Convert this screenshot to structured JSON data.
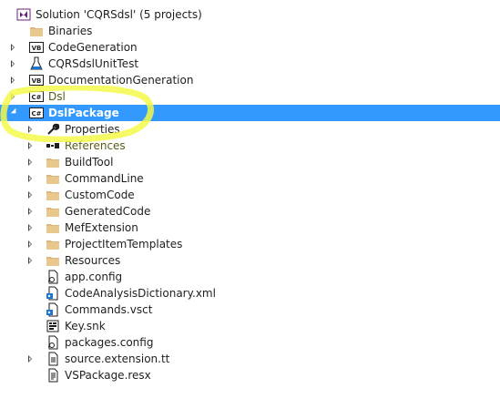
{
  "solution_explorer": {
    "items": [
      {
        "label": "Solution 'CQRSdsl' (5 projects)",
        "icon": "visual-studio-solution-icon",
        "expander": "none",
        "depth": 0,
        "state": "normal"
      },
      {
        "label": "Binaries",
        "icon": "folder-icon",
        "expander": "none",
        "depth": 1,
        "state": "normal"
      },
      {
        "label": "CodeGeneration",
        "icon": "vb-project-icon",
        "expander": "collapsed",
        "depth": 1,
        "state": "normal"
      },
      {
        "label": "CQRSdslUnitTest",
        "icon": "test-flask-icon",
        "expander": "collapsed",
        "depth": 1,
        "state": "normal"
      },
      {
        "label": "DocumentationGeneration",
        "icon": "vb-project-icon",
        "expander": "collapsed",
        "depth": 1,
        "state": "normal"
      },
      {
        "label": "Dsl",
        "icon": "csharp-project-icon",
        "expander": "collapsed",
        "depth": 1,
        "state": "highlight"
      },
      {
        "label": "DslPackage",
        "icon": "csharp-project-icon",
        "expander": "expanded",
        "depth": 1,
        "state": "selected"
      },
      {
        "label": "Properties",
        "icon": "wrench-icon",
        "expander": "collapsed",
        "depth": 2,
        "state": "normal"
      },
      {
        "label": "References",
        "icon": "references-icon",
        "expander": "collapsed",
        "depth": 2,
        "state": "highlight"
      },
      {
        "label": "BuildTool",
        "icon": "folder-icon",
        "expander": "collapsed",
        "depth": 2,
        "state": "normal"
      },
      {
        "label": "CommandLine",
        "icon": "folder-icon",
        "expander": "collapsed",
        "depth": 2,
        "state": "normal"
      },
      {
        "label": "CustomCode",
        "icon": "folder-icon",
        "expander": "collapsed",
        "depth": 2,
        "state": "normal"
      },
      {
        "label": "GeneratedCode",
        "icon": "folder-icon",
        "expander": "collapsed",
        "depth": 2,
        "state": "normal"
      },
      {
        "label": "MefExtension",
        "icon": "folder-icon",
        "expander": "collapsed",
        "depth": 2,
        "state": "normal"
      },
      {
        "label": "ProjectItemTemplates",
        "icon": "folder-icon",
        "expander": "collapsed",
        "depth": 2,
        "state": "normal"
      },
      {
        "label": "Resources",
        "icon": "folder-icon",
        "expander": "collapsed",
        "depth": 2,
        "state": "normal"
      },
      {
        "label": "app.config",
        "icon": "config-file-icon",
        "expander": "none",
        "depth": 2,
        "state": "normal"
      },
      {
        "label": "CodeAnalysisDictionary.xml",
        "icon": "xml-file-icon",
        "expander": "none",
        "depth": 2,
        "state": "normal"
      },
      {
        "label": "Commands.vsct",
        "icon": "xml-file-icon",
        "expander": "none",
        "depth": 2,
        "state": "normal"
      },
      {
        "label": "Key.snk",
        "icon": "key-file-icon",
        "expander": "none",
        "depth": 2,
        "state": "normal"
      },
      {
        "label": "packages.config",
        "icon": "config-file-icon",
        "expander": "none",
        "depth": 2,
        "state": "normal"
      },
      {
        "label": "source.extension.tt",
        "icon": "text-template-icon",
        "expander": "collapsed",
        "depth": 2,
        "state": "normal"
      },
      {
        "label": "VSPackage.resx",
        "icon": "resx-file-icon",
        "expander": "none",
        "depth": 2,
        "state": "normal"
      }
    ],
    "selection_color": "#3399ff",
    "annotation": {
      "name": "yellow-highlighter-marker",
      "color": "#f3f94a"
    }
  }
}
